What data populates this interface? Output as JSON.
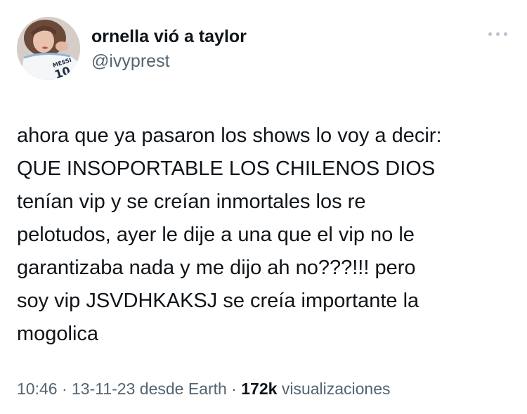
{
  "author": {
    "display_name": "ornella vió a taylor",
    "handle": "@ivyprest",
    "avatar_icon": "profile-photo",
    "avatar_shirt_text": "MESSI",
    "avatar_shirt_number": "10"
  },
  "menu": {
    "icon": "more-options-icon"
  },
  "tweet": {
    "lines": [
      "ahora que ya pasaron los shows lo voy a decir:",
      "QUE INSOPORTABLE LOS CHILENOS DIOS",
      "tenían vip y se creían inmortales los re",
      "pelotudos, ayer le dije a una que el vip no le",
      "garantizaba nada y me dijo ah no???!!! pero",
      "soy vip JSVDHKAKSJ se creía importante la",
      "mogolica"
    ]
  },
  "meta": {
    "time": "10:46",
    "sep1": " · ",
    "date": "13-11-23",
    "source": " desde Earth",
    "sep2": " · ",
    "views_count": "172k",
    "views_label": " visualizaciones"
  },
  "colors": {
    "text_primary": "#0f1419",
    "text_secondary": "#536471",
    "icon_muted": "#b9c3cc",
    "background": "#ffffff"
  }
}
